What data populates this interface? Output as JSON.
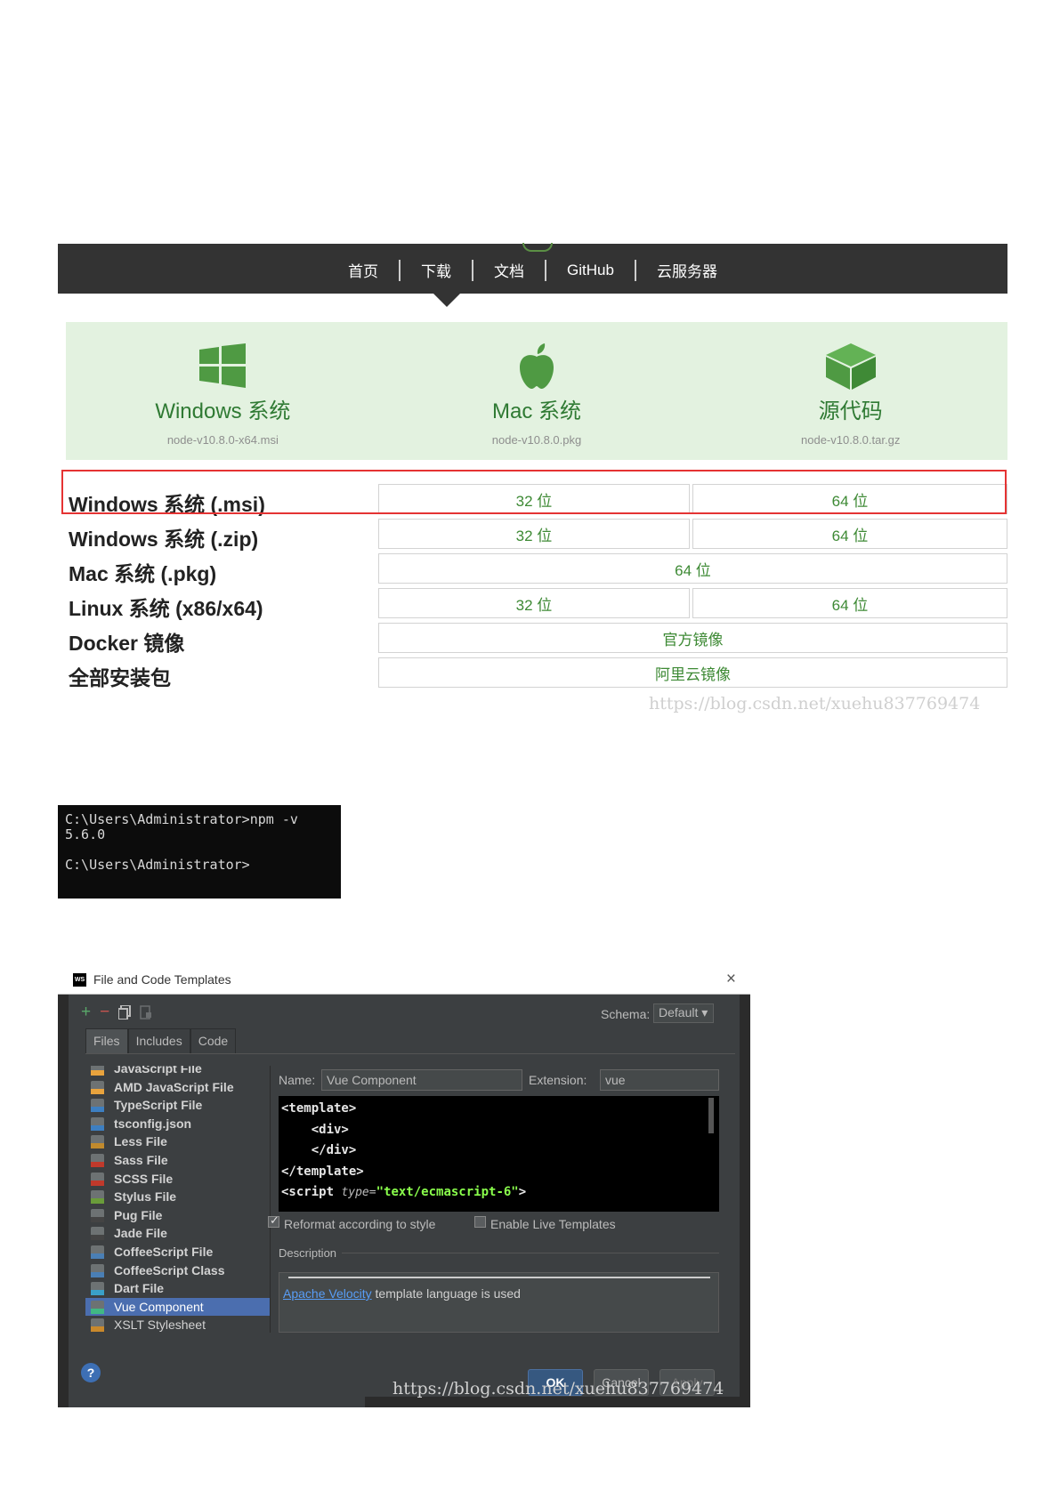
{
  "nav": {
    "items": [
      "首页",
      "下载",
      "文档",
      "GitHub",
      "云服务器"
    ]
  },
  "platforms": [
    {
      "name": "Windows 系统",
      "file": "node-v10.8.0-x64.msi",
      "icon": "windows-icon"
    },
    {
      "name": "Mac 系统",
      "file": "node-v10.8.0.pkg",
      "icon": "apple-icon"
    },
    {
      "name": "源代码",
      "file": "node-v10.8.0.tar.gz",
      "icon": "box-icon"
    }
  ],
  "downloads": [
    {
      "label": "Windows 系统 (.msi)",
      "links": [
        "32 位",
        "64 位"
      ]
    },
    {
      "label": "Windows 系统 (.zip)",
      "links": [
        "32 位",
        "64 位"
      ]
    },
    {
      "label": "Mac 系统 (.pkg)",
      "links": [
        "64 位"
      ]
    },
    {
      "label": "Linux 系统 (x86/x64)",
      "links": [
        "32 位",
        "64 位"
      ]
    },
    {
      "label": "Docker 镜像",
      "links": [
        "官方镜像"
      ]
    },
    {
      "label": "全部安装包",
      "links": [
        "阿里云镜像"
      ]
    }
  ],
  "watermark": "https://blog.csdn.net/xuehu837769474",
  "console": {
    "lines": [
      "C:\\Users\\Administrator>npm -v",
      "5.6.0",
      "",
      "C:\\Users\\Administrator>"
    ]
  },
  "ide": {
    "title": "File and Code Templates",
    "logo": "WS",
    "close": "×",
    "schema_label": "Schema:",
    "schema_value": "Default ▾",
    "tabs": [
      "Files",
      "Includes",
      "Code"
    ],
    "files": [
      {
        "name": "JavaScript File",
        "badge": "#e8a33d"
      },
      {
        "name": "AMD JavaScript File",
        "badge": "#e8a33d"
      },
      {
        "name": "TypeScript File",
        "badge": "#3d7fc1"
      },
      {
        "name": "tsconfig.json",
        "badge": "#3d7fc1"
      },
      {
        "name": "Less File",
        "badge": "#c18a2d"
      },
      {
        "name": "Sass File",
        "badge": "#c0392b"
      },
      {
        "name": "SCSS File",
        "badge": "#c0392b"
      },
      {
        "name": "Stylus File",
        "badge": "#6a9c3a"
      },
      {
        "name": "Pug File",
        "badge": "#444444"
      },
      {
        "name": "Jade File",
        "badge": "#444444"
      },
      {
        "name": "CoffeeScript File",
        "badge": "#4a7fb5"
      },
      {
        "name": "CoffeeScript Class",
        "badge": "#4a7fb5"
      },
      {
        "name": "Dart File",
        "badge": "#3aa0c8"
      },
      {
        "name": "Vue Component",
        "badge": "#41b883"
      },
      {
        "name": "XSLT Stylesheet",
        "badge": "#c9892c"
      }
    ],
    "selected_file": "Vue Component",
    "name_label": "Name:",
    "name_value": "Vue Component",
    "ext_label": "Extension:",
    "ext_value": "vue",
    "code": {
      "line1": "<template>",
      "line2": "<div>",
      "line3": "</div>",
      "line4": "</template>",
      "script_tag": "<script",
      "script_attr": "type=",
      "script_val": "\"text/ecmascript-6\"",
      "script_close": ">"
    },
    "reformat_label": "Reformat according to style",
    "reformat_checked": true,
    "live_label": "Enable Live Templates",
    "live_checked": false,
    "description_label": "Description",
    "description_link": "Apache Velocity",
    "description_text": " template language is used",
    "help": "?",
    "ok": "OK",
    "cancel": "Cancel",
    "apply": "Apply"
  }
}
